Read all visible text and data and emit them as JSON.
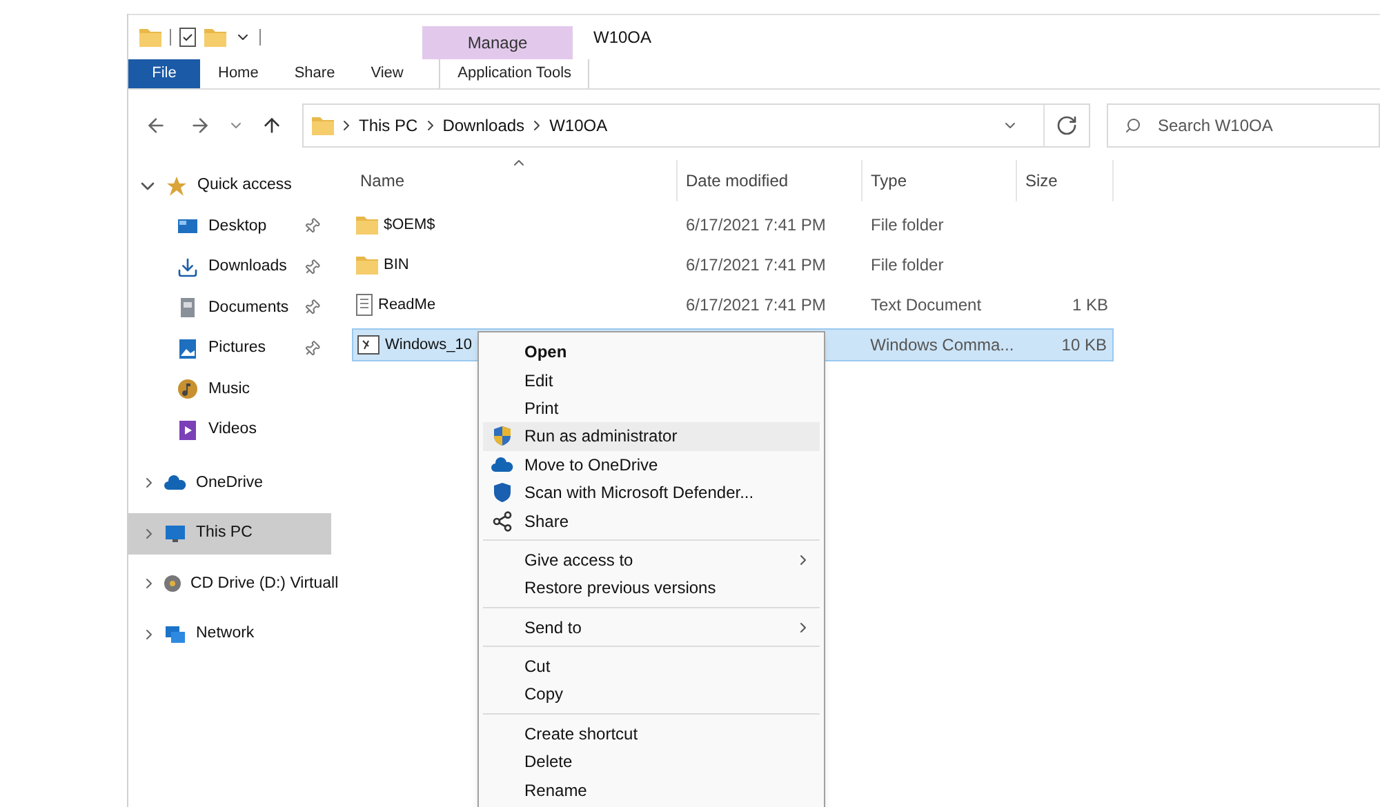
{
  "window": {
    "title": "W10OA"
  },
  "ribbon": {
    "context_group": "Manage",
    "tabs": [
      {
        "label": "File",
        "kind": "file",
        "selected": false
      },
      {
        "label": "Home",
        "kind": "plain",
        "selected": false
      },
      {
        "label": "Share",
        "kind": "plain",
        "selected": false
      },
      {
        "label": "View",
        "kind": "plain",
        "selected": false
      },
      {
        "label": "Application Tools",
        "kind": "context",
        "selected": false
      }
    ]
  },
  "address": {
    "path": [
      "This PC",
      "Downloads",
      "W10OA"
    ]
  },
  "search": {
    "placeholder": "Search W10OA"
  },
  "sidebar": {
    "items": [
      {
        "label": "Quick access",
        "kind": "star",
        "expanded": true,
        "selected": false,
        "children": [
          {
            "label": "Desktop",
            "kind": "desktop",
            "pinned": true,
            "selected": false
          },
          {
            "label": "Downloads",
            "kind": "download",
            "pinned": true,
            "selected": false
          },
          {
            "label": "Documents",
            "kind": "documents",
            "pinned": true,
            "selected": false
          },
          {
            "label": "Pictures",
            "kind": "pictures",
            "pinned": true,
            "selected": false
          },
          {
            "label": "Music",
            "kind": "music",
            "pinned": false,
            "selected": false
          },
          {
            "label": "Videos",
            "kind": "videos",
            "pinned": false,
            "selected": false
          }
        ]
      },
      {
        "label": "OneDrive",
        "kind": "cloud",
        "expanded": false,
        "selected": false
      },
      {
        "label": "This PC",
        "kind": "pc",
        "expanded": false,
        "selected": true
      },
      {
        "label": "CD Drive (D:) Virtuall",
        "kind": "cd",
        "expanded": false,
        "selected": false
      },
      {
        "label": "Network",
        "kind": "network",
        "expanded": false,
        "selected": false
      }
    ]
  },
  "table": {
    "columns": [
      "Name",
      "Date modified",
      "Type",
      "Size"
    ],
    "rows": [
      {
        "kind": "folder",
        "name": "$OEM$",
        "date": "6/17/2021 7:41 PM",
        "type": "File folder",
        "size": "",
        "selected": false
      },
      {
        "kind": "folder",
        "name": "BIN",
        "date": "6/17/2021 7:41 PM",
        "type": "File folder",
        "size": "",
        "selected": false
      },
      {
        "kind": "text",
        "name": "ReadMe",
        "date": "6/17/2021 7:41 PM",
        "type": "Text Document",
        "size": "1 KB",
        "selected": false
      },
      {
        "kind": "script",
        "name": "Windows_10",
        "date": "",
        "type": "Windows Comma...",
        "size": "10 KB",
        "selected": true
      }
    ]
  },
  "context_menu": {
    "groups": [
      [
        {
          "label": "Open",
          "kind": "plain",
          "default": true,
          "hovered": false,
          "submenu": false
        },
        {
          "label": "Edit",
          "kind": "plain",
          "default": false,
          "hovered": false,
          "submenu": false
        },
        {
          "label": "Print",
          "kind": "plain",
          "default": false,
          "hovered": false,
          "submenu": false
        },
        {
          "label": "Run as administrator",
          "kind": "shield",
          "default": false,
          "hovered": true,
          "submenu": false
        },
        {
          "label": "Move to OneDrive",
          "kind": "cloud",
          "default": false,
          "hovered": false,
          "submenu": false
        },
        {
          "label": "Scan with Microsoft Defender...",
          "kind": "defender",
          "default": false,
          "hovered": false,
          "submenu": false
        },
        {
          "label": "Share",
          "kind": "share",
          "default": false,
          "hovered": false,
          "submenu": false
        }
      ],
      [
        {
          "label": "Give access to",
          "kind": "plain",
          "default": false,
          "hovered": false,
          "submenu": true
        },
        {
          "label": "Restore previous versions",
          "kind": "plain",
          "default": false,
          "hovered": false,
          "submenu": false
        }
      ],
      [
        {
          "label": "Send to",
          "kind": "plain",
          "default": false,
          "hovered": false,
          "submenu": true
        }
      ],
      [
        {
          "label": "Cut",
          "kind": "plain",
          "default": false,
          "hovered": false,
          "submenu": false
        },
        {
          "label": "Copy",
          "kind": "plain",
          "default": false,
          "hovered": false,
          "submenu": false
        }
      ],
      [
        {
          "label": "Create shortcut",
          "kind": "plain",
          "default": false,
          "hovered": false,
          "submenu": false
        },
        {
          "label": "Delete",
          "kind": "plain",
          "default": false,
          "hovered": false,
          "submenu": false
        },
        {
          "label": "Rename",
          "kind": "plain",
          "default": false,
          "hovered": false,
          "submenu": false
        }
      ]
    ]
  }
}
